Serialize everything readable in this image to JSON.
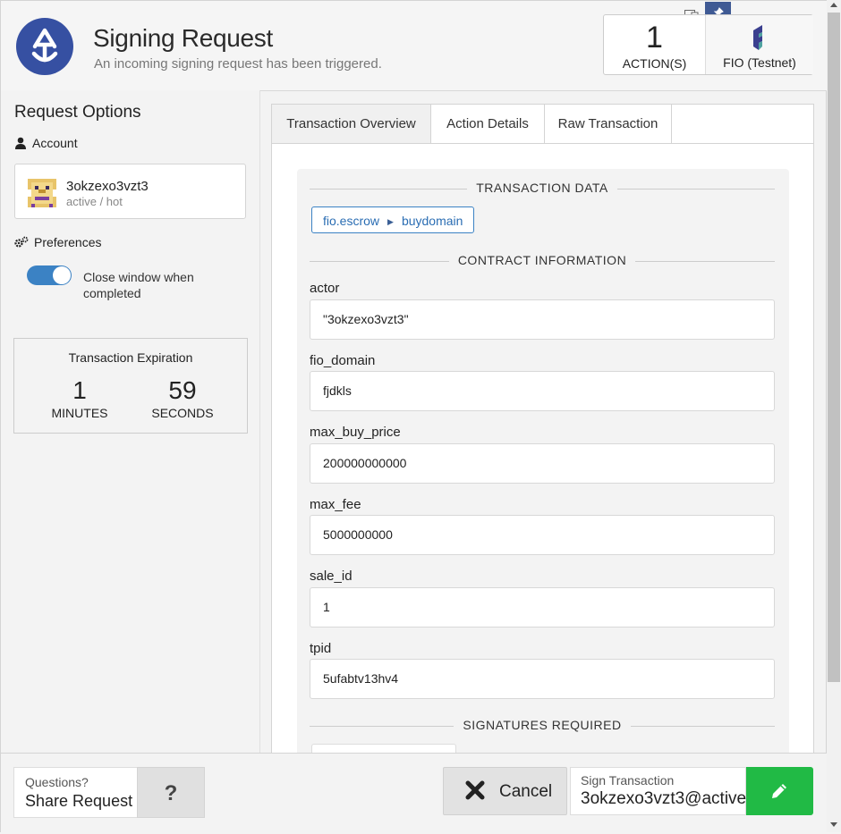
{
  "header": {
    "title": "Signing Request",
    "subtitle": "An incoming signing request has been triggered.",
    "action_count": "1",
    "action_label": "ACTION(S)",
    "chain_name": "FIO (Testnet)"
  },
  "sidebar": {
    "title": "Request Options",
    "account_section": "Account",
    "account_name": "3okzexo3vzt3",
    "account_permission": "active / hot",
    "preferences_section": "Preferences",
    "close_window_label": "Close window when completed",
    "close_window_enabled": true,
    "expiration": {
      "title": "Transaction Expiration",
      "minutes_value": "1",
      "minutes_label": "MINUTES",
      "seconds_value": "59",
      "seconds_label": "SECONDS"
    }
  },
  "tabs": [
    {
      "label": "Transaction Overview",
      "active": true
    },
    {
      "label": "Action Details",
      "active": false
    },
    {
      "label": "Raw Transaction",
      "active": false
    }
  ],
  "overview": {
    "transaction_data_heading": "TRANSACTION DATA",
    "contract": "fio.escrow",
    "action": "buydomain",
    "contract_info_heading": "CONTRACT INFORMATION",
    "fields": [
      {
        "label": "actor",
        "value": "\"3okzexo3vzt3\""
      },
      {
        "label": "fio_domain",
        "value": "fjdkls"
      },
      {
        "label": "max_buy_price",
        "value": "200000000000"
      },
      {
        "label": "max_fee",
        "value": "5000000000"
      },
      {
        "label": "sale_id",
        "value": "1"
      },
      {
        "label": "tpid",
        "value": "5ufabtv13hv4"
      }
    ],
    "signatures_heading": "SIGNATURES REQUIRED"
  },
  "footer": {
    "questions_label": "Questions?",
    "share_label": "Share Request",
    "help_label": "?",
    "cancel_label": "Cancel",
    "sign_label": "Sign Transaction",
    "sign_account": "3okzexo3vzt3@active"
  },
  "colors": {
    "brand_blue": "#3650a2",
    "accent_blue": "#3b82c4",
    "sign_green": "#21ba45"
  },
  "icons": {
    "logo": "anchor-logo-icon",
    "pin": "pin-icon",
    "chain": "fio-logo-icon",
    "account": "user-icon",
    "preferences": "gears-icon",
    "cancel": "close-icon",
    "sign": "pencil-icon"
  }
}
